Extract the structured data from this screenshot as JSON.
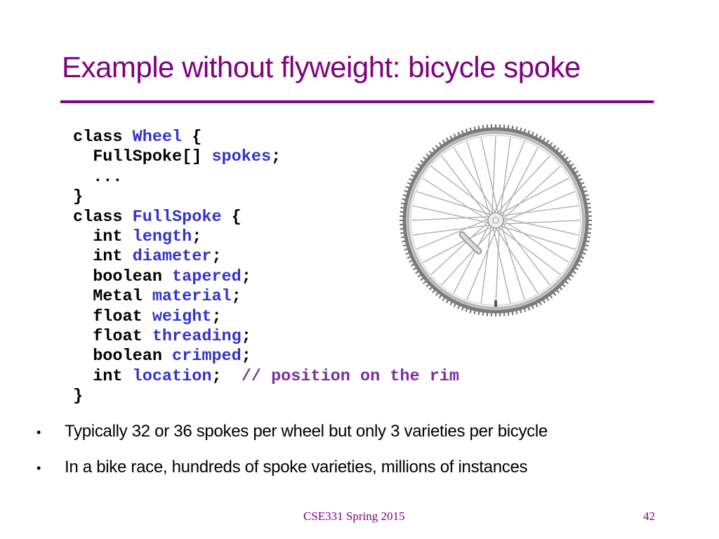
{
  "slide": {
    "title": "Example without flyweight:  bicycle spoke",
    "code_lines": [
      [
        {
          "t": "class ",
          "c": "kw"
        },
        {
          "t": "Wheel",
          "c": "id"
        },
        {
          "t": " {",
          "c": "kw"
        }
      ],
      [
        {
          "t": "  FullSpoke[] ",
          "c": "kw"
        },
        {
          "t": "spokes",
          "c": "id"
        },
        {
          "t": ";",
          "c": "kw"
        }
      ],
      [
        {
          "t": "  ...",
          "c": "kw"
        }
      ],
      [
        {
          "t": "}",
          "c": "kw"
        }
      ],
      [
        {
          "t": "class ",
          "c": "kw"
        },
        {
          "t": "FullSpoke",
          "c": "id"
        },
        {
          "t": " {",
          "c": "kw"
        }
      ],
      [
        {
          "t": "  int ",
          "c": "kw"
        },
        {
          "t": "length",
          "c": "id"
        },
        {
          "t": ";",
          "c": "kw"
        }
      ],
      [
        {
          "t": "  int ",
          "c": "kw"
        },
        {
          "t": "diameter",
          "c": "id"
        },
        {
          "t": ";",
          "c": "kw"
        }
      ],
      [
        {
          "t": "  boolean ",
          "c": "kw"
        },
        {
          "t": "tapered",
          "c": "id"
        },
        {
          "t": ";",
          "c": "kw"
        }
      ],
      [
        {
          "t": "  Metal ",
          "c": "kw"
        },
        {
          "t": "material",
          "c": "id"
        },
        {
          "t": ";",
          "c": "kw"
        }
      ],
      [
        {
          "t": "  float ",
          "c": "kw"
        },
        {
          "t": "weight",
          "c": "id"
        },
        {
          "t": ";",
          "c": "kw"
        }
      ],
      [
        {
          "t": "  float ",
          "c": "kw"
        },
        {
          "t": "threading",
          "c": "id"
        },
        {
          "t": ";",
          "c": "kw"
        }
      ],
      [
        {
          "t": "  boolean ",
          "c": "kw"
        },
        {
          "t": "crimped",
          "c": "id"
        },
        {
          "t": ";",
          "c": "kw"
        }
      ],
      [
        {
          "t": "  int ",
          "c": "kw"
        },
        {
          "t": "location",
          "c": "id"
        },
        {
          "t": ";  ",
          "c": "kw"
        },
        {
          "t": "// position on the rim",
          "c": "cm"
        }
      ],
      [
        {
          "t": "}",
          "c": "kw"
        }
      ]
    ],
    "bullets": [
      "Typically 32 or 36 spokes per wheel but only 3 varieties per bicycle",
      "In a bike race, hundreds of spoke varieties, millions of instances"
    ],
    "bullet_glyph": "•",
    "image": {
      "icon": "bicycle-wheel-icon",
      "spoke_count": 36
    },
    "footer": {
      "course": "CSE331 Spring 2015",
      "page_number": "42"
    },
    "colors": {
      "title": "#800080",
      "identifier": "#3333cc",
      "comment": "#7b2c9e"
    }
  }
}
